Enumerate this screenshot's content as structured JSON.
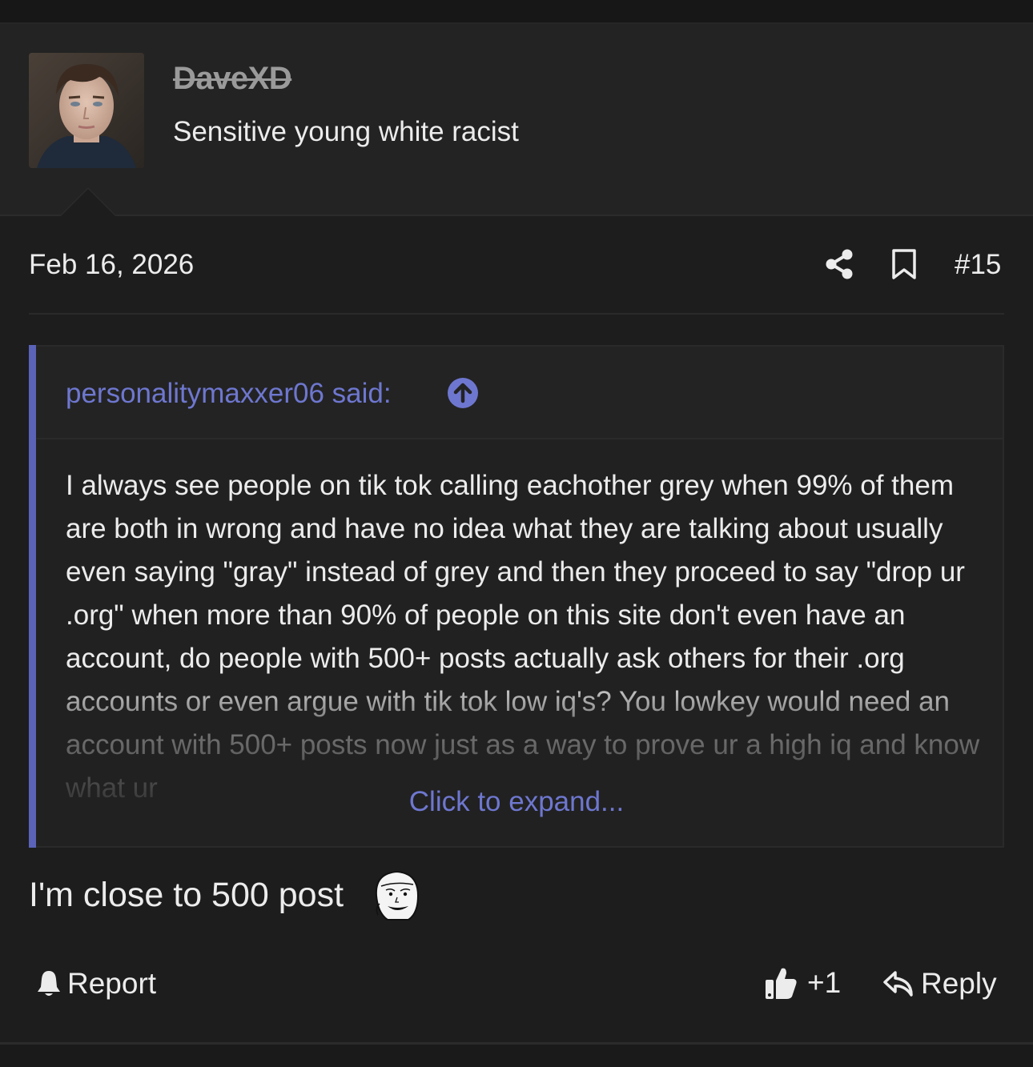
{
  "post": {
    "author": "DaveXD",
    "user_title": "Sensitive young white racist",
    "date": "Feb 16, 2026",
    "number": "#15",
    "body": "I'm close to 500 post"
  },
  "quote": {
    "author_said": "personalitymaxxer06 said:",
    "body": "I always see people on tik tok calling eachother grey when 99% of them are both in wrong and have no idea what they are talking about usually even saying \"gray\" instead of grey and then they proceed to say \"drop ur .org\" when more than 90% of people on this site don't even have an account, do people with 500+ posts actually ask others for their .org accounts or even argue with tik tok low iq's? You lowkey would need an account with 500+ posts now just as a way to prove ur a high iq and know what ur",
    "expand_label": "Click to expand..."
  },
  "actions": {
    "report_label": "Report",
    "like_count": "+1",
    "reply_label": "Reply"
  },
  "icons": {
    "share": "share-icon",
    "bookmark": "bookmark-icon",
    "quote_up": "arrow-up-circle-icon",
    "report": "bell-icon",
    "like": "thumbs-up-icon",
    "reply": "reply-arrow-icon",
    "emoji": "wojak-emoji-icon"
  },
  "colors": {
    "background": "#1d1d1d",
    "header_background": "#232323",
    "accent": "#6e77cf",
    "quote_bar": "#5a63b8",
    "text": "#ececec",
    "username": "#9a9a9a"
  }
}
